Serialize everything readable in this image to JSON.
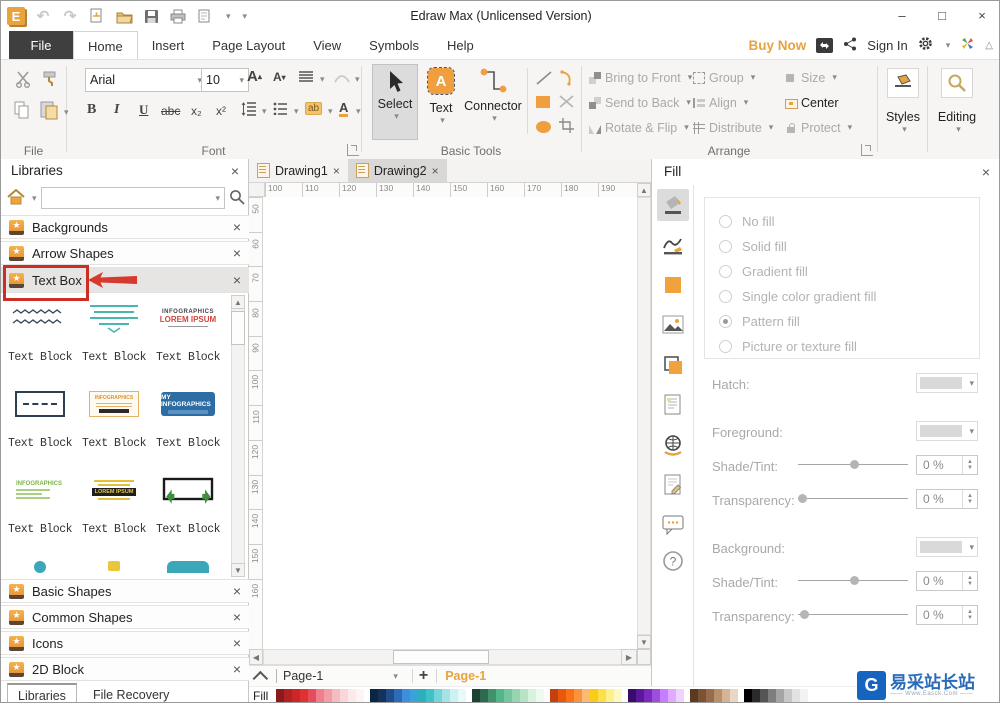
{
  "window": {
    "title": "Edraw Max (Unlicensed Version)",
    "minimize": "–",
    "maximize": "□",
    "close": "×"
  },
  "menu": {
    "tabs": [
      {
        "label": "File",
        "cls": "tab-file"
      },
      {
        "label": "Home",
        "cls": "tab-active"
      },
      {
        "label": "Insert",
        "cls": ""
      },
      {
        "label": "Page Layout",
        "cls": ""
      },
      {
        "label": "View",
        "cls": ""
      },
      {
        "label": "Symbols",
        "cls": ""
      },
      {
        "label": "Help",
        "cls": ""
      }
    ],
    "buy_now": "Buy Now",
    "sign_in": "Sign In"
  },
  "ribbon": {
    "groups": {
      "file": "File",
      "font": "Font",
      "basic_tools": "Basic Tools",
      "arrange": "Arrange"
    },
    "font": {
      "family": "Arial",
      "size": "10",
      "bold": "B",
      "italic": "I",
      "underline": "U",
      "strike": "abc",
      "subscript": "x₂",
      "superscript": "x²",
      "grow": "A",
      "shrink": "A",
      "highlight": "ab",
      "color": "A"
    },
    "tools": {
      "select": "Select",
      "text": "Text",
      "text_glyph": "A",
      "connector": "Connector"
    },
    "arrange_items": [
      {
        "label": "Bring to Front",
        "arrow": "▾",
        "cls": "dis",
        "icon": "ai-af"
      },
      {
        "label": "Group",
        "arrow": "▾",
        "cls": "dis",
        "icon": "ai-grp"
      },
      {
        "label": "Size",
        "arrow": "▾",
        "cls": "dis",
        "icon": "ai-sz"
      },
      {
        "label": "Send to Back",
        "arrow": "▾",
        "cls": "dis",
        "icon": "ai-ab"
      },
      {
        "label": "Align",
        "arrow": "▾",
        "cls": "dis",
        "icon": "ai-al"
      },
      {
        "label": "Center",
        "arrow": "",
        "cls": "en",
        "icon": "ai-ctr"
      },
      {
        "label": "Rotate & Flip",
        "arrow": "▾",
        "cls": "dis",
        "icon": "ai-rf"
      },
      {
        "label": "Distribute",
        "arrow": "▾",
        "cls": "dis",
        "icon": "ai-dist"
      },
      {
        "label": "Protect",
        "arrow": "▾",
        "cls": "dis",
        "icon": "ai-prot"
      }
    ],
    "styles_label": "Styles",
    "editing_label": "Editing"
  },
  "libraries": {
    "title": "Libraries",
    "sections_top": [
      "Backgrounds",
      "Arrow Shapes"
    ],
    "highlighted_section": "Text Box",
    "sections_bottom": [
      "Basic Shapes",
      "Common Shapes",
      "Icons",
      "2D Block"
    ],
    "blocks": [
      {
        "label": "Text Block",
        "thumb": "t1"
      },
      {
        "label": "Text Block",
        "thumb": "t2"
      },
      {
        "label": "Text Block",
        "thumb": "t3"
      },
      {
        "label": "Text Block",
        "thumb": "t4"
      },
      {
        "label": "Text Block",
        "thumb": "t5"
      },
      {
        "label": "Text Block",
        "thumb": "t6"
      },
      {
        "label": "Text Block",
        "thumb": "t7"
      },
      {
        "label": "Text Block",
        "thumb": "t8"
      },
      {
        "label": "Text Block",
        "thumb": "t9"
      }
    ],
    "thumb_texts": {
      "t3a": "INFOGRAPHICS",
      "t3b": "LOREM IPSUM",
      "t5a": "INFOGRAPHICS",
      "t6a": "MY INFOGRAPHICS",
      "t7a": "INFOGRAPHICS",
      "t8a": "LOREM IPSUM"
    },
    "tabs": [
      {
        "label": "Libraries",
        "cls": "on"
      },
      {
        "label": "File Recovery",
        "cls": ""
      }
    ]
  },
  "canvas": {
    "tabs": [
      {
        "label": "Drawing1",
        "cls": ""
      },
      {
        "label": "Drawing2",
        "cls": "sel"
      }
    ],
    "h_ruler": [
      "100",
      "110",
      "120",
      "130",
      "140",
      "150",
      "160",
      "170",
      "180",
      "190"
    ],
    "v_ruler": [
      "50",
      "60",
      "70",
      "80",
      "90",
      "100",
      "110",
      "120",
      "130",
      "140",
      "150",
      "160"
    ],
    "page_nav": {
      "current": "Page-1",
      "add": "+",
      "active_tab": "Page-1"
    }
  },
  "fill_panel": {
    "title": "Fill",
    "options": [
      {
        "label": "No fill",
        "cls": ""
      },
      {
        "label": "Solid fill",
        "cls": ""
      },
      {
        "label": "Gradient fill",
        "cls": ""
      },
      {
        "label": "Single color gradient fill",
        "cls": ""
      },
      {
        "label": "Pattern fill",
        "cls": "on"
      },
      {
        "label": "Picture or texture fill",
        "cls": ""
      }
    ],
    "fields": {
      "hatch": "Hatch:",
      "foreground": "Foreground:",
      "shade_tint": "Shade/Tint:",
      "transparency": "Transparency:",
      "background": "Background:",
      "percent": "0 %"
    }
  },
  "bottom": {
    "fill_label": "Fill",
    "palette": [
      {
        "c": "#8b1a1a",
        "g": ""
      },
      {
        "c": "#b22222",
        "g": ""
      },
      {
        "c": "#cd2626",
        "g": ""
      },
      {
        "c": "#e03131",
        "g": ""
      },
      {
        "c": "#e74c5c",
        "g": ""
      },
      {
        "c": "#ef7f8a",
        "g": ""
      },
      {
        "c": "#f29da6",
        "g": ""
      },
      {
        "c": "#f6bcc1",
        "g": ""
      },
      {
        "c": "#fad6d9",
        "g": ""
      },
      {
        "c": "#fce9ea",
        "g": ""
      },
      {
        "c": "#fef4f4",
        "g": ""
      },
      {
        "c": "#0b2545",
        "g": "gap"
      },
      {
        "c": "#13315c",
        "g": ""
      },
      {
        "c": "#1d4e89",
        "g": ""
      },
      {
        "c": "#2d6cb5",
        "g": ""
      },
      {
        "c": "#3e8ede",
        "g": ""
      },
      {
        "c": "#38a3d8",
        "g": ""
      },
      {
        "c": "#2cb1bc",
        "g": ""
      },
      {
        "c": "#3fc1c9",
        "g": ""
      },
      {
        "c": "#74d4d8",
        "g": ""
      },
      {
        "c": "#a5e3e6",
        "g": ""
      },
      {
        "c": "#cdf1f2",
        "g": ""
      },
      {
        "c": "#e8f9f9",
        "g": ""
      },
      {
        "c": "#1b4332",
        "g": "gap"
      },
      {
        "c": "#2d6a4f",
        "g": ""
      },
      {
        "c": "#40916c",
        "g": ""
      },
      {
        "c": "#52b788",
        "g": ""
      },
      {
        "c": "#74c69d",
        "g": ""
      },
      {
        "c": "#95d5b2",
        "g": ""
      },
      {
        "c": "#b7e4c7",
        "g": ""
      },
      {
        "c": "#d8f3dc",
        "g": ""
      },
      {
        "c": "#ecfaef",
        "g": ""
      },
      {
        "c": "#c2410c",
        "g": "gap"
      },
      {
        "c": "#ea580c",
        "g": ""
      },
      {
        "c": "#f97316",
        "g": ""
      },
      {
        "c": "#fb923c",
        "g": ""
      },
      {
        "c": "#fdba74",
        "g": ""
      },
      {
        "c": "#facc15",
        "g": ""
      },
      {
        "c": "#fde047",
        "g": ""
      },
      {
        "c": "#fef08a",
        "g": ""
      },
      {
        "c": "#fef9c3",
        "g": ""
      },
      {
        "c": "#3c096c",
        "g": "gap"
      },
      {
        "c": "#5a189a",
        "g": ""
      },
      {
        "c": "#7b2cbf",
        "g": ""
      },
      {
        "c": "#9d4edd",
        "g": ""
      },
      {
        "c": "#c77dff",
        "g": ""
      },
      {
        "c": "#e0aaff",
        "g": ""
      },
      {
        "c": "#efd3ff",
        "g": ""
      },
      {
        "c": "#5c3a21",
        "g": "gap"
      },
      {
        "c": "#7b5233",
        "g": ""
      },
      {
        "c": "#9a6b4a",
        "g": ""
      },
      {
        "c": "#b8906b",
        "g": ""
      },
      {
        "c": "#d4b494",
        "g": ""
      },
      {
        "c": "#e9d7c3",
        "g": ""
      },
      {
        "c": "#000000",
        "g": "gap"
      },
      {
        "c": "#2b2b2b",
        "g": ""
      },
      {
        "c": "#555555",
        "g": ""
      },
      {
        "c": "#7e7e7e",
        "g": ""
      },
      {
        "c": "#a5a5a5",
        "g": ""
      },
      {
        "c": "#c8c8c8",
        "g": ""
      },
      {
        "c": "#e2e2e2",
        "g": ""
      },
      {
        "c": "#f2f2f2",
        "g": ""
      }
    ]
  },
  "watermark": {
    "logo": "G",
    "text": "易采站长站",
    "sub": "—— Www.Easck.Com ——"
  }
}
